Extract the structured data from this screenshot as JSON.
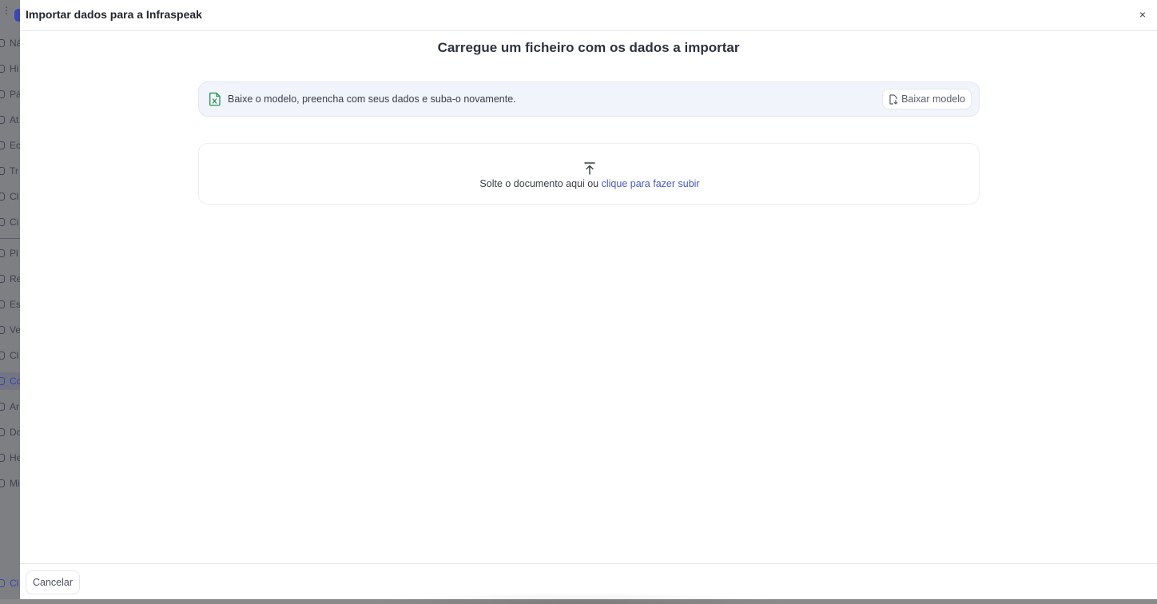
{
  "background_sidebar": {
    "items": [
      "Ná",
      "Hi",
      "Pá",
      "At",
      "Ec",
      "Tr",
      "Cl",
      "Ci",
      "Pl",
      "Re",
      "Es",
      "Ve",
      "Cl",
      "Cc",
      "Ar",
      "Dc",
      "He",
      "Mi"
    ],
    "bottom_item": "Cl"
  },
  "modal": {
    "title": "Importar dados para a Infraspeak",
    "close_icon": "×",
    "heading": "Carregue um ficheiro com os dados a importar",
    "template_banner": {
      "text": "Baixe o modelo, preencha com seus dados e suba-o novamente.",
      "download_label": "Baixar modelo"
    },
    "dropzone": {
      "text": "Solte o documento aqui ou ",
      "link_text": "clique para fazer subir"
    },
    "footer": {
      "cancel_label": "Cancelar"
    }
  },
  "colors": {
    "accent": "#4458d3",
    "excel_green": "#2f9e5b",
    "banner_bg": "#f2f4fb"
  },
  "icons": {
    "excel": "excel-file-icon",
    "download": "file-download-icon",
    "upload": "upload-icon",
    "close": "close-icon"
  }
}
